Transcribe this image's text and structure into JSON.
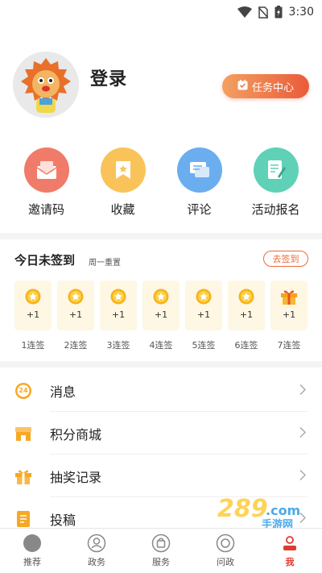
{
  "status_bar": {
    "time": "3:30"
  },
  "profile": {
    "login_label": "登录",
    "task_button": "任务中心"
  },
  "quick_actions": [
    {
      "label": "邀请码",
      "icon": "envelope-icon",
      "color": "#f07b69"
    },
    {
      "label": "收藏",
      "icon": "bookmark-icon",
      "color": "#f9c35a"
    },
    {
      "label": "评论",
      "icon": "comment-icon",
      "color": "#6aaef0"
    },
    {
      "label": "活动报名",
      "icon": "form-icon",
      "color": "#5fd1b7"
    }
  ],
  "checkin": {
    "title": "今日未签到",
    "subtitle": "周一重置",
    "button": "去签到",
    "days": [
      {
        "points": "+1",
        "label": "1连签",
        "icon": "coin-icon"
      },
      {
        "points": "+1",
        "label": "2连签",
        "icon": "coin-icon"
      },
      {
        "points": "+1",
        "label": "3连签",
        "icon": "coin-icon"
      },
      {
        "points": "+1",
        "label": "4连签",
        "icon": "coin-icon"
      },
      {
        "points": "+1",
        "label": "5连签",
        "icon": "coin-icon"
      },
      {
        "points": "+1",
        "label": "6连签",
        "icon": "coin-icon"
      },
      {
        "points": "+1",
        "label": "7连签",
        "icon": "gift-box-icon"
      }
    ]
  },
  "menu": [
    {
      "label": "消息",
      "icon": "message-badge-icon",
      "badge": "24"
    },
    {
      "label": "积分商城",
      "icon": "shop-icon"
    },
    {
      "label": "抽奖记录",
      "icon": "gift-icon"
    },
    {
      "label": "投稿",
      "icon": "manuscript-icon"
    }
  ],
  "tabs": [
    {
      "label": "推荐",
      "icon": "home-dot-icon"
    },
    {
      "label": "政务",
      "icon": "people-icon"
    },
    {
      "label": "服务",
      "icon": "bag-icon"
    },
    {
      "label": "问政",
      "icon": "question-icon"
    },
    {
      "label": "我",
      "icon": "user-icon",
      "active": true
    }
  ],
  "colors": {
    "accent": "#ea6b3e",
    "active_tab": "#e03a2f",
    "checkin_card": "#fdf7e4"
  }
}
